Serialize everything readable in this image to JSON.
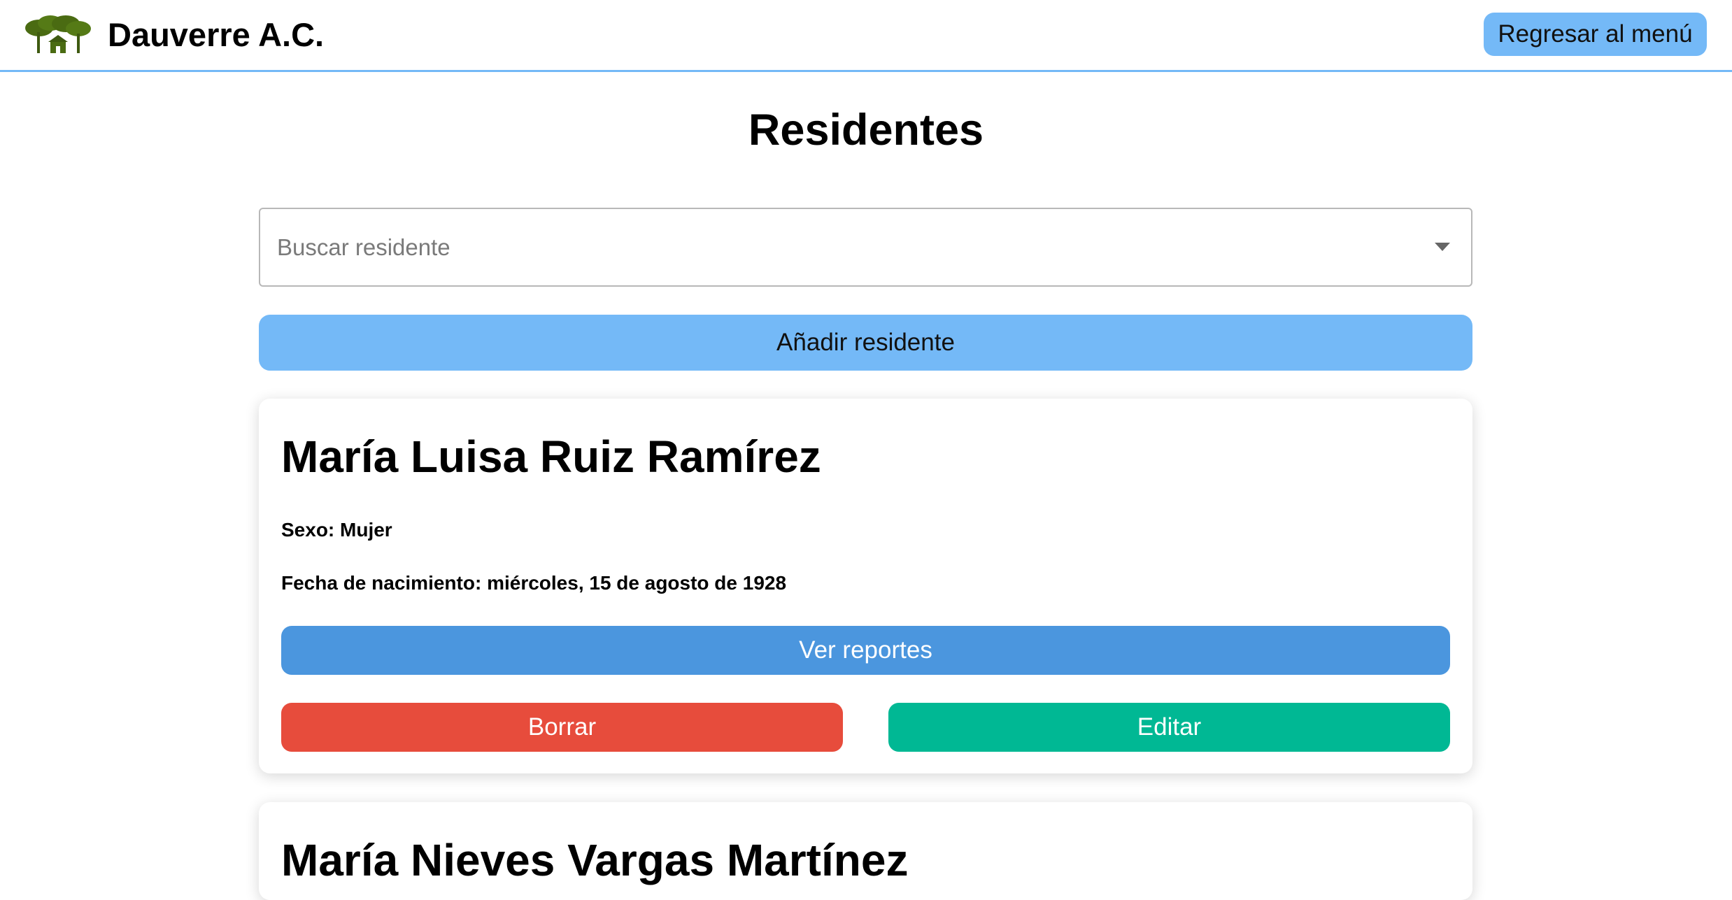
{
  "header": {
    "brand": "Dauverre A.C.",
    "logo_icon": "trees-house-logo",
    "back_label": "Regresar al menú"
  },
  "page": {
    "title": "Residentes"
  },
  "search": {
    "placeholder": "Buscar residente",
    "value": "",
    "icon": "chevron-down-icon"
  },
  "add_label": "Añadir residente",
  "residents": [
    {
      "name": "María Luisa Ruiz Ramírez",
      "sexo": "Sexo: Mujer",
      "fecha": "Fecha de nacimiento: miércoles, 15 de agosto de 1928",
      "reports_label": "Ver reportes",
      "delete_label": "Borrar",
      "edit_label": "Editar"
    },
    {
      "name": "María Nieves Vargas Martínez"
    }
  ],
  "colors": {
    "accent": "#74b9f7",
    "reports": "#4b96de",
    "delete": "#e74c3c",
    "edit": "#00b894",
    "logo_green": "#4a6b12"
  }
}
